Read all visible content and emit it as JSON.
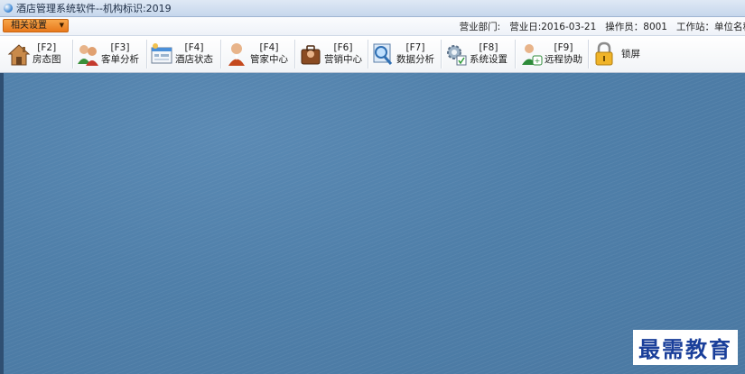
{
  "window": {
    "title": "酒店管理系统软件--机构标识:2019"
  },
  "menu": {
    "settings_label": "相关设置"
  },
  "status": {
    "department": "营业部门:",
    "business_date": "营业日:2016-03-21",
    "operator": "操作员：8001",
    "workstation": "工作站：单位名称"
  },
  "toolbar": {
    "items": [
      {
        "key": "[F2]",
        "label": "房态图",
        "icon": "house-icon"
      },
      {
        "key": "[F3]",
        "label": "客单分析",
        "icon": "customers-icon"
      },
      {
        "key": "[F4]",
        "label": "酒店状态",
        "icon": "hotel-status-icon"
      },
      {
        "key": "[F4]",
        "label": "管家中心",
        "icon": "butler-icon"
      },
      {
        "key": "[F6]",
        "label": "营销中心",
        "icon": "marketing-icon"
      },
      {
        "key": "[F7]",
        "label": "数据分析",
        "icon": "magnifier-icon"
      },
      {
        "key": "[F8]",
        "label": "系统设置",
        "icon": "gear-icon"
      },
      {
        "key": "[F9]",
        "label": "远程协助",
        "icon": "remote-assist-icon"
      }
    ],
    "lock_label": "锁屏"
  },
  "watermark": {
    "text": "最需教育"
  },
  "colors": {
    "workspace": "#4f7fa9",
    "accent": "#e8791c"
  }
}
